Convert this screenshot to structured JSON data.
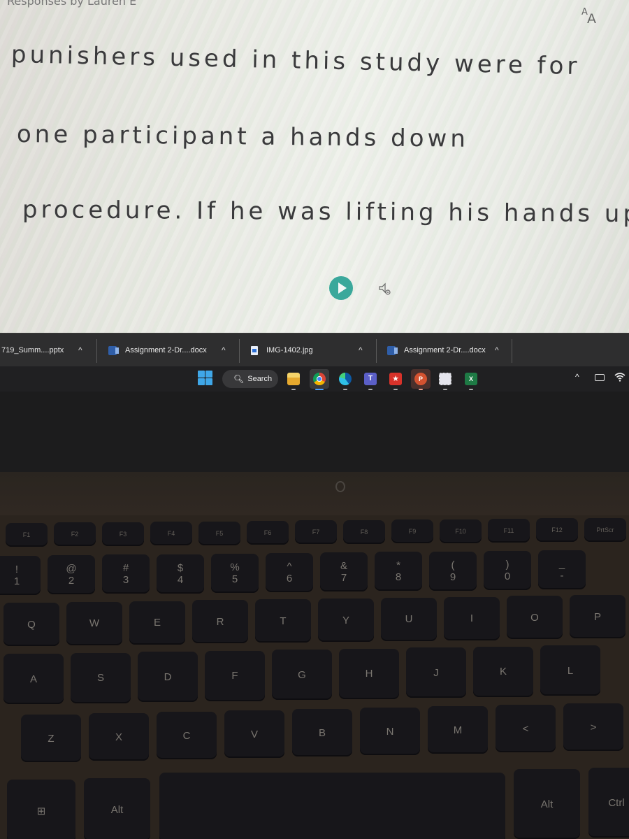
{
  "document": {
    "top_partial_text": "Responses by Lauren E",
    "font_size_button": {
      "label_small": "A",
      "label_large": "A",
      "icon": "text-size-icon"
    },
    "lines": [
      "punishers used in this study were for",
      "one participant a hands down",
      "procedure. If he was lifting his hands up"
    ],
    "media": {
      "play_icon": "play-icon",
      "audio_settings_icon": "speaker-settings-icon",
      "accent_color": "#3aa89b"
    }
  },
  "downloads_bar": {
    "items": [
      {
        "filename": "719_Summ....pptx",
        "icon": "powerpoint-file-icon"
      },
      {
        "filename": "Assignment 2-Dr....docx",
        "icon": "word-file-icon"
      },
      {
        "filename": "IMG-1402.jpg",
        "icon": "image-file-icon"
      },
      {
        "filename": "Assignment 2-Dr....docx",
        "icon": "word-file-icon"
      }
    ],
    "chevron": "^"
  },
  "taskbar": {
    "search_label": "Search",
    "apps": [
      {
        "name": "File Explorer",
        "icon": "folder-icon",
        "color": "#f2c14e"
      },
      {
        "name": "Google Chrome",
        "icon": "chrome-icon",
        "color": "#4285f4",
        "active": true
      },
      {
        "name": "Microsoft Edge",
        "icon": "edge-icon",
        "color": "#1fa0d8"
      },
      {
        "name": "Microsoft Teams",
        "icon": "teams-icon",
        "color": "#5b5fc7"
      },
      {
        "name": "Adobe Acrobat",
        "icon": "acrobat-icon",
        "color": "#d8322a"
      },
      {
        "name": "PowerPoint",
        "icon": "powerpoint-icon",
        "color": "#d35230"
      },
      {
        "name": "Snipping Tool",
        "icon": "snipping-tool-icon",
        "color": "#9a9aa8"
      },
      {
        "name": "Excel",
        "icon": "excel-icon",
        "color": "#1e7a45"
      }
    ],
    "tray": {
      "chevron": "^",
      "keyboard_icon": "keyboard-icon",
      "wifi_icon": "wifi-icon"
    }
  },
  "keyboard": {
    "function_row": [
      "F1",
      "F2",
      "F3",
      "F4",
      "F5",
      "F6",
      "F7",
      "F8",
      "F9",
      "F10",
      "F11",
      "F12",
      "PrtScr"
    ],
    "number_row": [
      {
        "top": "!",
        "bottom": "1"
      },
      {
        "top": "@",
        "bottom": "2"
      },
      {
        "top": "#",
        "bottom": "3"
      },
      {
        "top": "$",
        "bottom": "4"
      },
      {
        "top": "%",
        "bottom": "5"
      },
      {
        "top": "^",
        "bottom": "6"
      },
      {
        "top": "&",
        "bottom": "7"
      },
      {
        "top": "*",
        "bottom": "8"
      },
      {
        "top": "(",
        "bottom": "9"
      },
      {
        "top": ")",
        "bottom": "0"
      },
      {
        "top": "_",
        "bottom": "-"
      }
    ],
    "row_q": [
      "Q",
      "W",
      "E",
      "R",
      "T",
      "Y",
      "U",
      "I",
      "O",
      "P"
    ],
    "row_a": [
      "A",
      "S",
      "D",
      "F",
      "G",
      "H",
      "J",
      "K",
      "L"
    ],
    "row_z": [
      "Z",
      "X",
      "C",
      "V",
      "B",
      "N",
      "M",
      "<",
      ">"
    ],
    "bottom_row": {
      "win": "⊞",
      "alt": "Alt",
      "space": "",
      "alt_right": "Alt",
      "ctrl": "Ctrl"
    }
  }
}
